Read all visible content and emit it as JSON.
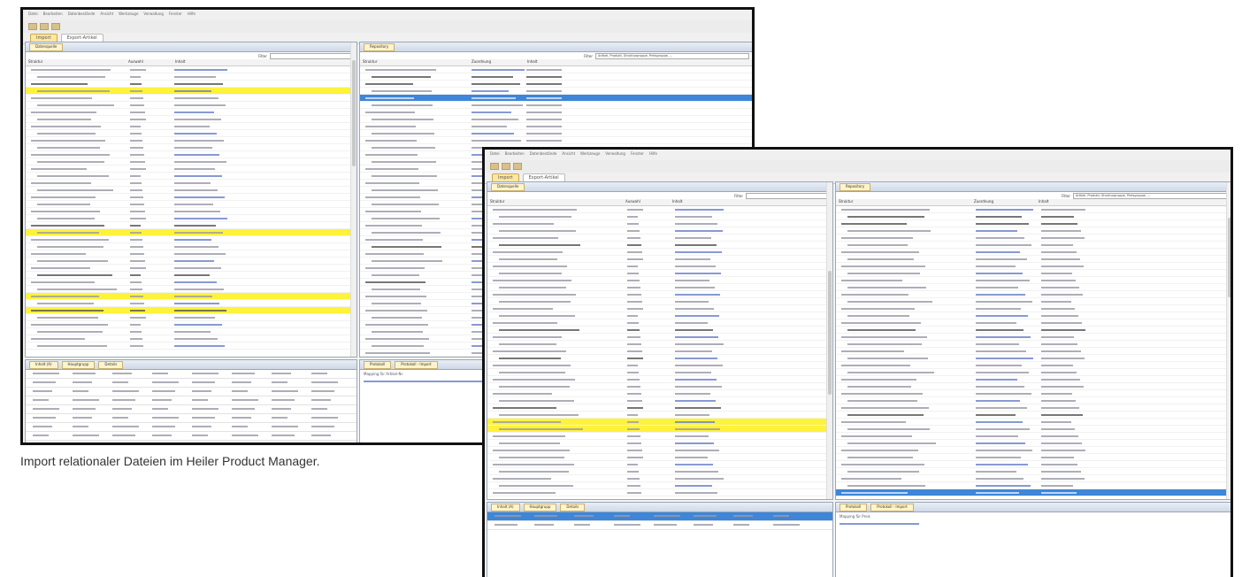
{
  "caption": "Import relationaler Dateien im Heiler Product Manager.",
  "windows": [
    {
      "name": "import-window-1",
      "menu": [
        "Datei",
        "Bearbeiten",
        "Datenbestände",
        "Ansicht",
        "Werkzeuge",
        "Verwaltung",
        "Fenster",
        "Hilfe"
      ],
      "tabs": [
        "Import",
        "Export-Artikel"
      ],
      "left_pane": {
        "tab": "Datenquelle",
        "filter_label": "Filter",
        "columns": [
          "Struktur",
          "Auswahl",
          "Inhalt"
        ]
      },
      "right_pane": {
        "tab": "Repository",
        "filter_label": "Filter",
        "filter_value": "Artikel, Produkt, Strukturgruppe, Preisgruppe, ...",
        "columns": [
          "Struktur",
          "Zuordnung",
          "Inhalt"
        ]
      },
      "bottom_left": {
        "tabs": [
          "Inhalt (A)",
          "Hauptgrupp",
          "Details"
        ]
      },
      "bottom_right": {
        "tabs": [
          "Protokoll",
          "Protokoll - Import"
        ],
        "mapping_label": "Mapping für Artikel-Nr."
      }
    },
    {
      "name": "import-window-2",
      "menu": [
        "Datei",
        "Bearbeiten",
        "Datenbestände",
        "Ansicht",
        "Werkzeuge",
        "Verwaltung",
        "Fenster",
        "Hilfe"
      ],
      "tabs": [
        "Import",
        "Export-Artikel"
      ],
      "left_pane": {
        "tab": "Datenquelle",
        "filter_label": "Filter",
        "columns": [
          "Struktur",
          "Auswahl",
          "Inhalt"
        ]
      },
      "right_pane": {
        "tab": "Repository",
        "filter_label": "Filter",
        "filter_value": "Artikel, Produkt, Strukturgruppe, Preisgruppe, ...",
        "columns": [
          "Struktur",
          "Zuordnung",
          "Inhalt"
        ]
      },
      "bottom_left": {
        "tabs": [
          "Inhalt (A)",
          "Hauptgrupp",
          "Details"
        ]
      },
      "bottom_right": {
        "tabs": [
          "Protokoll",
          "Protokoll - Import"
        ],
        "mapping_label": "Mapping für Preis"
      }
    }
  ],
  "colors": {
    "highlight": "#fff23a",
    "selection": "#3d86d9",
    "frame": "#111111"
  }
}
